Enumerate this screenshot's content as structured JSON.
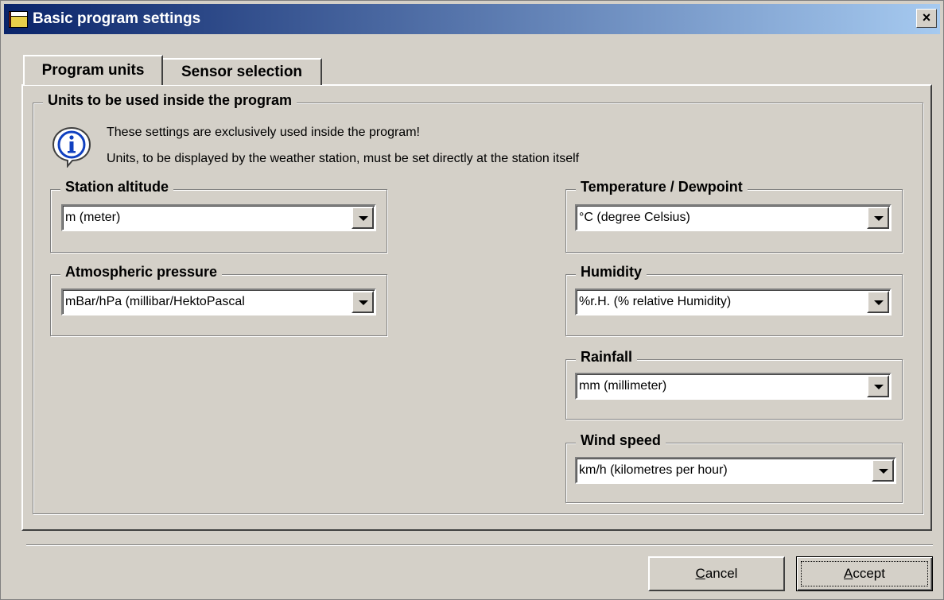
{
  "window": {
    "title": "Basic program settings",
    "close_label": "×"
  },
  "tabs": [
    {
      "label": "Program units",
      "active": true
    },
    {
      "label": "Sensor selection",
      "active": false
    }
  ],
  "units_group": {
    "legend": "Units to be used inside the program",
    "info_line1": "These settings are exclusively used inside the program!",
    "info_line2": "Units, to be displayed by the weather station, must be set directly at the station itself"
  },
  "fields": {
    "station_altitude": {
      "label": "Station altitude",
      "value": "m (meter)"
    },
    "atmospheric_pressure": {
      "label": "Atmospheric pressure",
      "value": "mBar/hPa (millibar/HektoPascal"
    },
    "temperature": {
      "label": "Temperature / Dewpoint",
      "value": "°C (degree Celsius)"
    },
    "humidity": {
      "label": "Humidity",
      "value": "%r.H. (% relative Humidity)"
    },
    "rainfall": {
      "label": "Rainfall",
      "value": "mm (millimeter)"
    },
    "wind_speed": {
      "label": "Wind speed",
      "value": "km/h (kilometres per hour)"
    }
  },
  "buttons": {
    "cancel_first": "C",
    "cancel_rest": "ancel",
    "accept_first": "A",
    "accept_rest": "ccept"
  },
  "colors": {
    "titlebar_start": "#0a246a",
    "titlebar_end": "#a6caf0",
    "face": "#d4d0c8"
  }
}
